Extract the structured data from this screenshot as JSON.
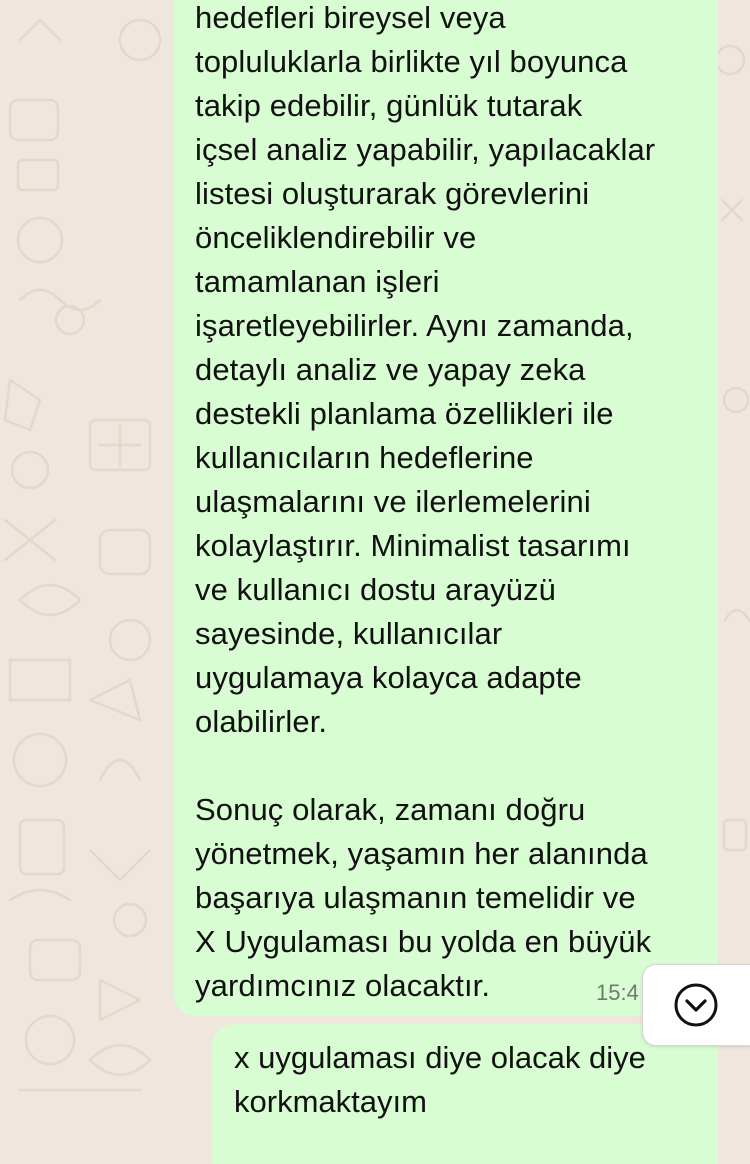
{
  "chat": {
    "messages": [
      {
        "direction": "outgoing",
        "text": "hedefleri bireysel veya\ntopluluklarla birlikte yıl boyunca\ntakip edebilir, günlük tutarak\niçsel analiz yapabilir, yapılacaklar\nlistesi oluşturarak görevlerini\nönceliklendirebilir ve\ntamamlanan işleri\nişaretleyebilirler. Aynı zamanda,\ndetaylı analiz ve yapay zeka\ndestekli planlama özellikleri ile\nkullanıcıların hedeflerine\nulaşmalarını ve ilerlemelerini\nkolaylaştırır. Minimalist tasarımı\nve kullanıcı dostu arayüzü\nsayesinde, kullanıcılar\nuygulamaya kolayca adapte\nolabilirler.\n\nSonuç olarak, zamanı doğru\nyönetmek, yaşamın her alanında\nbaşarıya ulaşmanın temelidir ve\nX Uygulaması bu yolda en büyük\nyardımcınız olacaktır.",
        "time": "15:4"
      },
      {
        "direction": "outgoing",
        "text": "x uygulaması diye olacak diye\nkorkmaktayım"
      }
    ]
  },
  "scroll_to_bottom": {
    "icon": "chevron-down-circle-icon"
  },
  "colors": {
    "wallpaper": "#efe7dd",
    "outgoing_bubble": "#d9fdd3",
    "timestamp": "#6f7a6e"
  }
}
